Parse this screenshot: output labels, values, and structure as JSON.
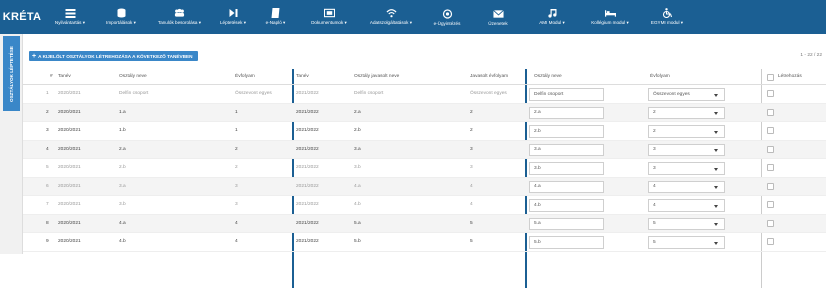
{
  "app": {
    "logo": "KRÉTA",
    "brand_color": "#1b5f93",
    "accent_color": "#3a87c8"
  },
  "nav": [
    {
      "label": "Nyilvántartás ▾",
      "icon": "list-icon"
    },
    {
      "label": "Importálások ▾",
      "icon": "database-icon"
    },
    {
      "label": "Tanulók besorolása ▾",
      "icon": "group-icon"
    },
    {
      "label": "Léptetések ▾",
      "icon": "step-icon"
    },
    {
      "label": "e-Napló ▾",
      "icon": "book-icon"
    },
    {
      "label": "Dokumentumok ▾",
      "icon": "document-icon"
    },
    {
      "label": "Adatszolgáltatások ▾",
      "icon": "wifi-icon"
    },
    {
      "label": "e-Ügyintézés",
      "icon": "at-icon"
    },
    {
      "label": "Üzenetek",
      "icon": "mail-icon"
    },
    {
      "label": "AMI Modul ▾",
      "icon": "music-icon"
    },
    {
      "label": "Kollégium modul ▾",
      "icon": "bed-icon"
    },
    {
      "label": "EGYMI modul ▾",
      "icon": "wheelchair-icon"
    }
  ],
  "sidebar": {
    "tabs": [
      "OSZTÁLYOK LÉPTETÉSE",
      "",
      ""
    ]
  },
  "toolbar": {
    "action_label": "A KIJELÖLT OSZTÁLYOK LÉTREHOZÁSA A KÖVETKEZŐ TANÉVBEN",
    "pager": "1 - 22 / 22"
  },
  "table": {
    "headers": {
      "num": "#",
      "tanev": "Tanév",
      "osztaly": "Osztály neve",
      "evfolyam": "Évfolyam",
      "tanev2": "Tanév",
      "javasolt_nev": "Osztály javasolt neve",
      "javasolt_evf": "Javasolt évfolyam",
      "uj_nev": "Osztály neve",
      "uj_evf": "Évfolyam",
      "letrehozas": "Létrehozás"
    },
    "rows": [
      {
        "num": "1",
        "tanev": "2020/2021",
        "osztaly": "Delfin csoport",
        "evfolyam": "Összevont egyes",
        "tanev2": "2021/2022",
        "javasolt_nev": "Delfin csoport",
        "javasolt_evf": "Összevont egyes",
        "uj_nev": "Delfin csoport",
        "uj_evf": "Összevont egyes",
        "muted": true
      },
      {
        "num": "2",
        "tanev": "2020/2021",
        "osztaly": "1.a",
        "evfolyam": "1",
        "tanev2": "2021/2022",
        "javasolt_nev": "2.a",
        "javasolt_evf": "2",
        "uj_nev": "2.a",
        "uj_evf": "2",
        "muted": false
      },
      {
        "num": "3",
        "tanev": "2020/2021",
        "osztaly": "1.b",
        "evfolyam": "1",
        "tanev2": "2021/2022",
        "javasolt_nev": "2.b",
        "javasolt_evf": "2",
        "uj_nev": "2.b",
        "uj_evf": "2",
        "muted": false
      },
      {
        "num": "4",
        "tanev": "2020/2021",
        "osztaly": "2.a",
        "evfolyam": "2",
        "tanev2": "2021/2022",
        "javasolt_nev": "3.a",
        "javasolt_evf": "3",
        "uj_nev": "3.a",
        "uj_evf": "3",
        "muted": false
      },
      {
        "num": "5",
        "tanev": "2020/2021",
        "osztaly": "2.b",
        "evfolyam": "2",
        "tanev2": "2021/2022",
        "javasolt_nev": "3.b",
        "javasolt_evf": "3",
        "uj_nev": "3.b",
        "uj_evf": "3",
        "muted": true
      },
      {
        "num": "6",
        "tanev": "2020/2021",
        "osztaly": "3.a",
        "evfolyam": "3",
        "tanev2": "2021/2022",
        "javasolt_nev": "4.a",
        "javasolt_evf": "4",
        "uj_nev": "4.a",
        "uj_evf": "4",
        "muted": true
      },
      {
        "num": "7",
        "tanev": "2020/2021",
        "osztaly": "3.b",
        "evfolyam": "3",
        "tanev2": "2021/2022",
        "javasolt_nev": "4.b",
        "javasolt_evf": "4",
        "uj_nev": "4.b",
        "uj_evf": "4",
        "muted": true
      },
      {
        "num": "8",
        "tanev": "2020/2021",
        "osztaly": "4.a",
        "evfolyam": "4",
        "tanev2": "2021/2022",
        "javasolt_nev": "5.a",
        "javasolt_evf": "5",
        "uj_nev": "5.a",
        "uj_evf": "5",
        "muted": false
      },
      {
        "num": "9",
        "tanev": "2020/2021",
        "osztaly": "4.b",
        "evfolyam": "4",
        "tanev2": "2021/2022",
        "javasolt_nev": "5.b",
        "javasolt_evf": "5",
        "uj_nev": "5.b",
        "uj_evf": "5",
        "muted": false
      }
    ]
  }
}
